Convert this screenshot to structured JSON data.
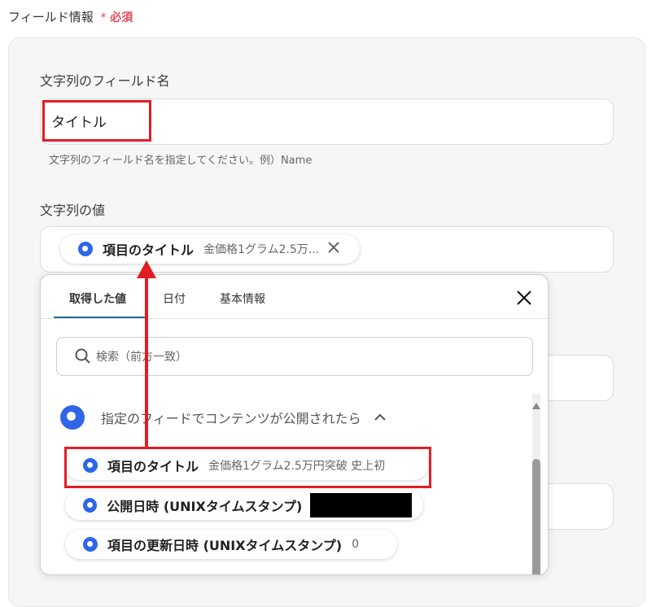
{
  "section": {
    "title": "フィールド情報",
    "required_mark": "*",
    "required_text": "必須"
  },
  "field_name": {
    "label": "文字列のフィールド名",
    "value": "タイトル",
    "help": "文字列のフィールド名を指定してください。例）Name"
  },
  "field_value": {
    "label": "文字列の値",
    "chip": {
      "name": "項目のタイトル",
      "value": "金価格1グラム2.5万..."
    }
  },
  "popup": {
    "tabs": [
      {
        "label": "取得した値"
      },
      {
        "label": "日付"
      },
      {
        "label": "基本情報"
      }
    ],
    "search_placeholder": "検索（前方一致）",
    "group_title": "指定のフィードでコンテンツが公開されたら",
    "items": [
      {
        "name": "項目のタイトル",
        "value": "金価格1グラム2.5万円突破 史上初"
      },
      {
        "name": "公開日時 (UNIXタイムスタンプ)",
        "value": ""
      },
      {
        "name": "項目の更新日時 (UNIXタイムスタンプ)",
        "value": "0"
      }
    ]
  },
  "colors": {
    "accent": "#2f66e8",
    "highlight": "#e11d24",
    "tab_underline": "#1f6f8b"
  }
}
